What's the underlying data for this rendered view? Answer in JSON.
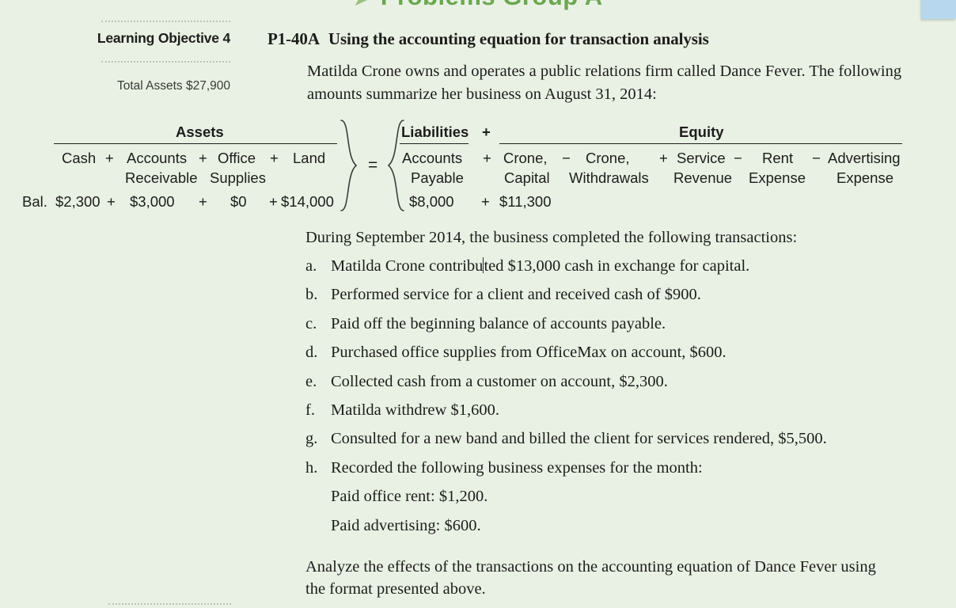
{
  "header": {
    "chevron": "➤",
    "title": "Problems Group A"
  },
  "margin": {
    "learning_objective": "Learning Objective 4",
    "total_assets": "Total Assets $27,900"
  },
  "problem": {
    "code": "P1-40A",
    "title": "Using the accounting equation for transaction analysis",
    "intro": "Matilda Crone owns and operates a public relations firm called Dance Fever. The following amounts summarize her business on August 31, 2014:",
    "transactions_intro": "During September 2014, the business completed the following transactions:",
    "closing": "Analyze the effects of the transactions on the accounting equation of Dance Fever using the format presented above."
  },
  "equation": {
    "group_assets": "Assets",
    "group_liabilities": "Liabilities",
    "group_equity": "Equity",
    "equals": "=",
    "plus_between_groups": "+",
    "balance_label": "Bal.",
    "assets_columns": [
      {
        "line1": "Cash",
        "line2": "",
        "value": "$2,300"
      },
      {
        "line1": "Accounts",
        "line2": "Receivable",
        "value": "$3,000"
      },
      {
        "line1": "Office",
        "line2": "Supplies",
        "value": "$0"
      },
      {
        "line1": "Land",
        "line2": "",
        "value": "$14,000"
      }
    ],
    "liabilities_columns": [
      {
        "line1": "Accounts",
        "line2": "Payable",
        "value": "$8,000"
      }
    ],
    "equity_columns": [
      {
        "op": "+",
        "line1": "Crone,",
        "line2": "Capital",
        "value": "$11,300"
      },
      {
        "op": "−",
        "line1": "Crone,",
        "line2": "Withdrawals",
        "value": ""
      },
      {
        "op": "+",
        "line1": "Service",
        "line2": "Revenue",
        "value": ""
      },
      {
        "op": "−",
        "line1": "Rent",
        "line2": "Expense",
        "value": ""
      },
      {
        "op": "−",
        "line1": "Advertising",
        "line2": "Expense",
        "value": ""
      }
    ],
    "operators": {
      "plus": "+",
      "minus": "−"
    }
  },
  "transactions": [
    {
      "marker": "a.",
      "text_before_caret": "Matilda Crone contribu",
      "text_after_caret": "ted $13,000 cash in exchange for capital.",
      "has_caret": true
    },
    {
      "marker": "b.",
      "text": "Performed service for a client and received cash of $900.",
      "has_caret": false
    },
    {
      "marker": "c.",
      "text": "Paid off the beginning balance of accounts payable.",
      "has_caret": false
    },
    {
      "marker": "d.",
      "text": "Purchased office supplies from OfficeMax on account, $600.",
      "has_caret": false
    },
    {
      "marker": "e.",
      "text": "Collected cash from a customer on account, $2,300.",
      "has_caret": false
    },
    {
      "marker": "f.",
      "text": "Matilda withdrew $1,600.",
      "has_caret": false
    },
    {
      "marker": "g.",
      "text": "Consulted for a new band and billed the client for services rendered, $5,500.",
      "has_caret": false
    },
    {
      "marker": "h.",
      "text": "Recorded the following business expenses for the month:",
      "has_caret": false
    }
  ],
  "expense_sublines": [
    "Paid office rent: $1,200.",
    "Paid advertising: $600."
  ],
  "colors": {
    "page_background": "#e9f1e4",
    "header_green": "#6aa84f",
    "text": "#1d1d1b",
    "rule_dotted": "#b9c7b2",
    "corner_chip": "#b7d7ef"
  }
}
